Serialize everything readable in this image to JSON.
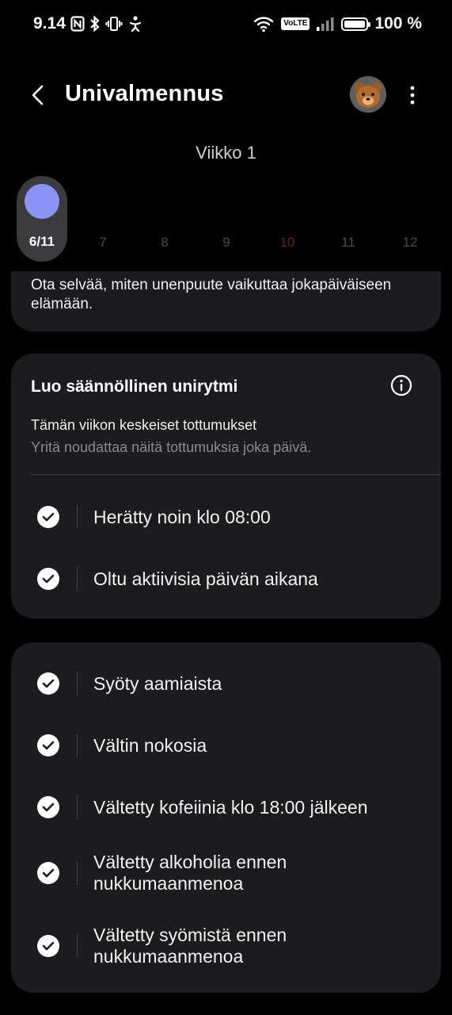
{
  "status_bar": {
    "time": "9.14",
    "battery": "100 %",
    "network": "VoLTE"
  },
  "header": {
    "title": "Univalmennus"
  },
  "week": {
    "label": "Viikko 1",
    "selected_day": "6/11",
    "days": [
      "7",
      "8",
      "9",
      "10",
      "11",
      "12"
    ]
  },
  "intro": {
    "text": "Ota selvää, miten unenpuute vaikuttaa jokapäiväiseen elämään."
  },
  "rhythm_card": {
    "title": "Luo säännöllinen unirytmi",
    "habits_title": "Tämän viikon keskeiset tottumukset",
    "habits_subtitle": "Yritä noudattaa näitä tottumuksia joka päivä.",
    "items": [
      {
        "label": "Herätty noin klo 08:00"
      },
      {
        "label": "Oltu aktiivisia päivän aikana"
      }
    ]
  },
  "habit_list": {
    "items": [
      {
        "label": "Syöty aamiaista"
      },
      {
        "label": "Vältin nokosia"
      },
      {
        "label": "Vältetty kofeiinia klo 18:00 jälkeen"
      },
      {
        "label": "Vältetty alkoholia ennen nukkumaanmenoa"
      },
      {
        "label": "Vältetty syömistä ennen nukkumaanmenoa"
      }
    ]
  },
  "colors": {
    "accent": "#8a94f4",
    "card": "#1c1c1e",
    "background": "#000000"
  }
}
